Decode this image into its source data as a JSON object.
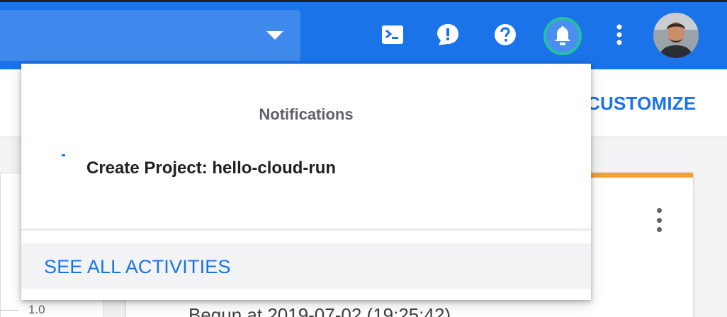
{
  "header": {
    "project_dropdown": {
      "icon": "caret-down-icon"
    },
    "icons": [
      {
        "name": "cloud-shell-icon"
      },
      {
        "name": "feedback-icon"
      },
      {
        "name": "help-icon"
      },
      {
        "name": "notifications-bell-icon"
      },
      {
        "name": "more-vert-icon"
      }
    ],
    "avatar": "user-avatar"
  },
  "dashboard": {
    "customize_label": "CUSTOMIZE",
    "axis_tick": "1.0",
    "activity_text": "Begun at 2019-07-02 (19:25:42)"
  },
  "notifications": {
    "title": "Notifications",
    "items": [
      {
        "text": "Create Project: hello-cloud-run",
        "status": "in-progress"
      }
    ],
    "see_all_label": "SEE ALL ACTIVITIES"
  },
  "colors": {
    "topbar": "#1a73e8",
    "link": "#1a73e8",
    "bell_ring": "#24c1a0",
    "card_accent": "#f0a22a"
  }
}
